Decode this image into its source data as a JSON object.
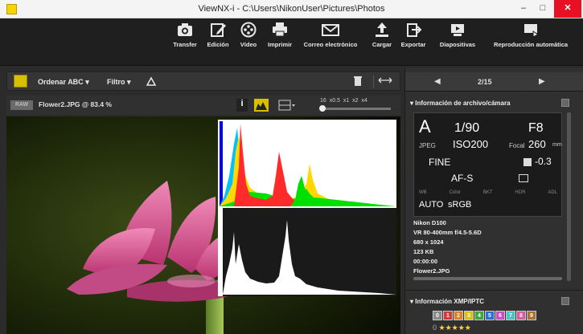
{
  "window": {
    "title": "ViewNX-i - C:\\Users\\NikonUser\\Pictures\\Photos",
    "min_glyph": "–",
    "max_glyph": "□",
    "close_glyph": "✕"
  },
  "toolbar": {
    "items": [
      {
        "label": "Transfer",
        "icon": "camera-icon"
      },
      {
        "label": "Edición",
        "icon": "edit-icon"
      },
      {
        "label": "Vídeo",
        "icon": "film-reel-icon"
      },
      {
        "label": "Imprimir",
        "icon": "printer-icon"
      },
      {
        "label": "Correo electrónico",
        "icon": "envelope-icon"
      },
      {
        "label": "Cargar",
        "icon": "upload-icon"
      },
      {
        "label": "Exportar",
        "icon": "export-icon"
      },
      {
        "label": "Diapositivas",
        "icon": "slideshow-icon"
      },
      {
        "label": "Reproducción automática",
        "icon": "autoplay-icon"
      }
    ]
  },
  "subbar": {
    "sort_label": "Ordenar",
    "sort_value": "ABC",
    "filter_label": "Filtro",
    "dropdown_glyph": "▾"
  },
  "infobar": {
    "raw_badge": "RAW",
    "filename": "Flower2.JPG @ 83.4 %",
    "info_glyph": "i",
    "zoom_ticks": [
      "16",
      "x0.5",
      "x1",
      "x2",
      "x4"
    ]
  },
  "navigator": {
    "prev": "◀",
    "next": "▶",
    "position": "2/15"
  },
  "file_info": {
    "header": "Información de archivo/cámara",
    "mode": "A",
    "shutter": "1/90",
    "aperture": "F8",
    "format": "JPEG",
    "iso": "ISO200",
    "focal_label": "Focal",
    "focal": "260",
    "focal_unit": "mm",
    "quality": "FINE",
    "exposure_comp": "-0.3",
    "af_mode": "AF-S",
    "wb_labels": [
      "WB",
      "Color",
      "BKT",
      "HDR",
      "ADL"
    ],
    "wb": "AUTO",
    "color_space": "sRGB",
    "camera": "Nikon D100",
    "lens": "VR 80-400mm f/4.5-5.6D",
    "dimensions": "680 x 1024",
    "size": "123 KB",
    "time": "00:00:00",
    "file": "Flower2.JPG"
  },
  "xmp": {
    "header": "Información XMP/IPTC",
    "labels": [
      "0",
      "1",
      "2",
      "3",
      "4",
      "5",
      "6",
      "7",
      "8",
      "9"
    ],
    "label_colors": [
      "#888888",
      "#d13b3b",
      "#d9822b",
      "#d8c21a",
      "#3fa53f",
      "#2e6fd1",
      "#c84fbd",
      "#4fc3c3",
      "#d85a9e",
      "#a8733a"
    ],
    "rating_zero": "0",
    "rating_stars": "★★★★★"
  },
  "colors": {
    "accent": "#d8c000",
    "close": "#e81123"
  }
}
